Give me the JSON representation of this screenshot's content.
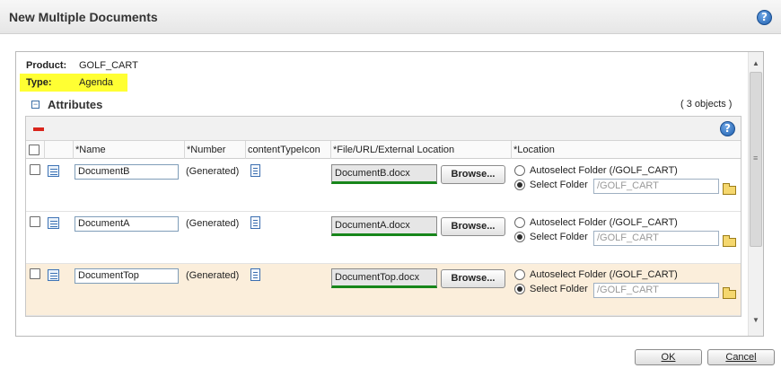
{
  "dialog": {
    "title": "New Multiple Documents"
  },
  "properties": {
    "product_label": "Product:",
    "product_value": "GOLF_CART",
    "type_label": "Type:",
    "type_value": "Agenda"
  },
  "attributes": {
    "title": "Attributes",
    "toggle": "−",
    "count": "( 3 objects )",
    "columns": [
      "*Name",
      "*Number",
      "contentTypeIcon",
      "*File/URL/External Location",
      "*Location"
    ],
    "rows": [
      {
        "name": "DocumentB",
        "number": "(Generated)",
        "file": "DocumentB.docx",
        "browse": "Browse...",
        "auto_label": "Autoselect Folder (/GOLF_CART)",
        "select_label": "Select Folder",
        "folder_value": "/GOLF_CART",
        "selected": false
      },
      {
        "name": "DocumentA",
        "number": "(Generated)",
        "file": "DocumentA.docx",
        "browse": "Browse...",
        "auto_label": "Autoselect Folder (/GOLF_CART)",
        "select_label": "Select Folder",
        "folder_value": "/GOLF_CART",
        "selected": false
      },
      {
        "name": "DocumentTop",
        "number": "(Generated)",
        "file": "DocumentTop.docx",
        "browse": "Browse...",
        "auto_label": "Autoselect Folder (/GOLF_CART)",
        "select_label": "Select Folder",
        "folder_value": "/GOLF_CART",
        "selected": true
      }
    ]
  },
  "buttons": {
    "ok": "OK",
    "cancel": "Cancel"
  },
  "icons": {
    "help": "help-icon",
    "remove": "remove-icon",
    "detail": "detail-icon",
    "content_type": "document-icon",
    "folder": "folder-icon"
  },
  "colors": {
    "highlight": "#ffff33",
    "selected_row": "#fbeedb",
    "upload_ok": "#17861a",
    "remove": "#d9251c"
  },
  "scroll": {
    "vertical_level": 0.1
  }
}
